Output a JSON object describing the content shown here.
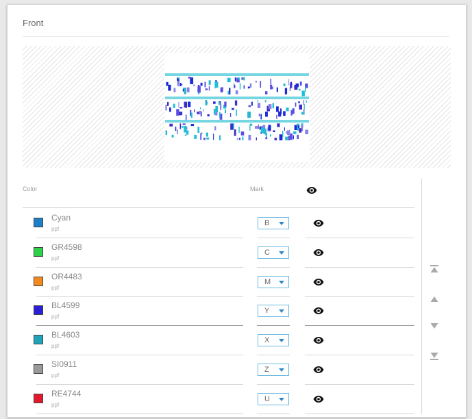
{
  "panel": {
    "title": "Front"
  },
  "table": {
    "color_header": "Color",
    "mark_header": "Mark",
    "visibility_icon": "eye-icon"
  },
  "rows": [
    {
      "name": "Cyan",
      "sub": "ppf",
      "mark": "B",
      "color": "#1e7fc8",
      "visibility_icon": "eye-icon"
    },
    {
      "name": "GR4598",
      "sub": "ppf",
      "mark": "C",
      "color": "#2fd04a",
      "visibility_icon": "eye-icon"
    },
    {
      "name": "OR4483",
      "sub": "ppf",
      "mark": "M",
      "color": "#f08a1e",
      "visibility_icon": "eye-icon"
    },
    {
      "name": "BL4599",
      "sub": "ppf",
      "mark": "Y",
      "color": "#2a1fd6",
      "visibility_icon": "eye-icon"
    },
    {
      "name": "BL4603",
      "sub": "ppf",
      "mark": "X",
      "color": "#1ea3b8",
      "visibility_icon": "eye-icon"
    },
    {
      "name": "SI0911",
      "sub": "ppf",
      "mark": "Z",
      "color": "#9a9a9a",
      "visibility_icon": "eye-icon"
    },
    {
      "name": "RE4744",
      "sub": "ppf",
      "mark": "U",
      "color": "#e0192d",
      "visibility_icon": "eye-icon"
    }
  ],
  "order_controls": [
    "move-to-top-icon",
    "move-up-icon",
    "move-down-icon",
    "move-to-bottom-icon"
  ]
}
